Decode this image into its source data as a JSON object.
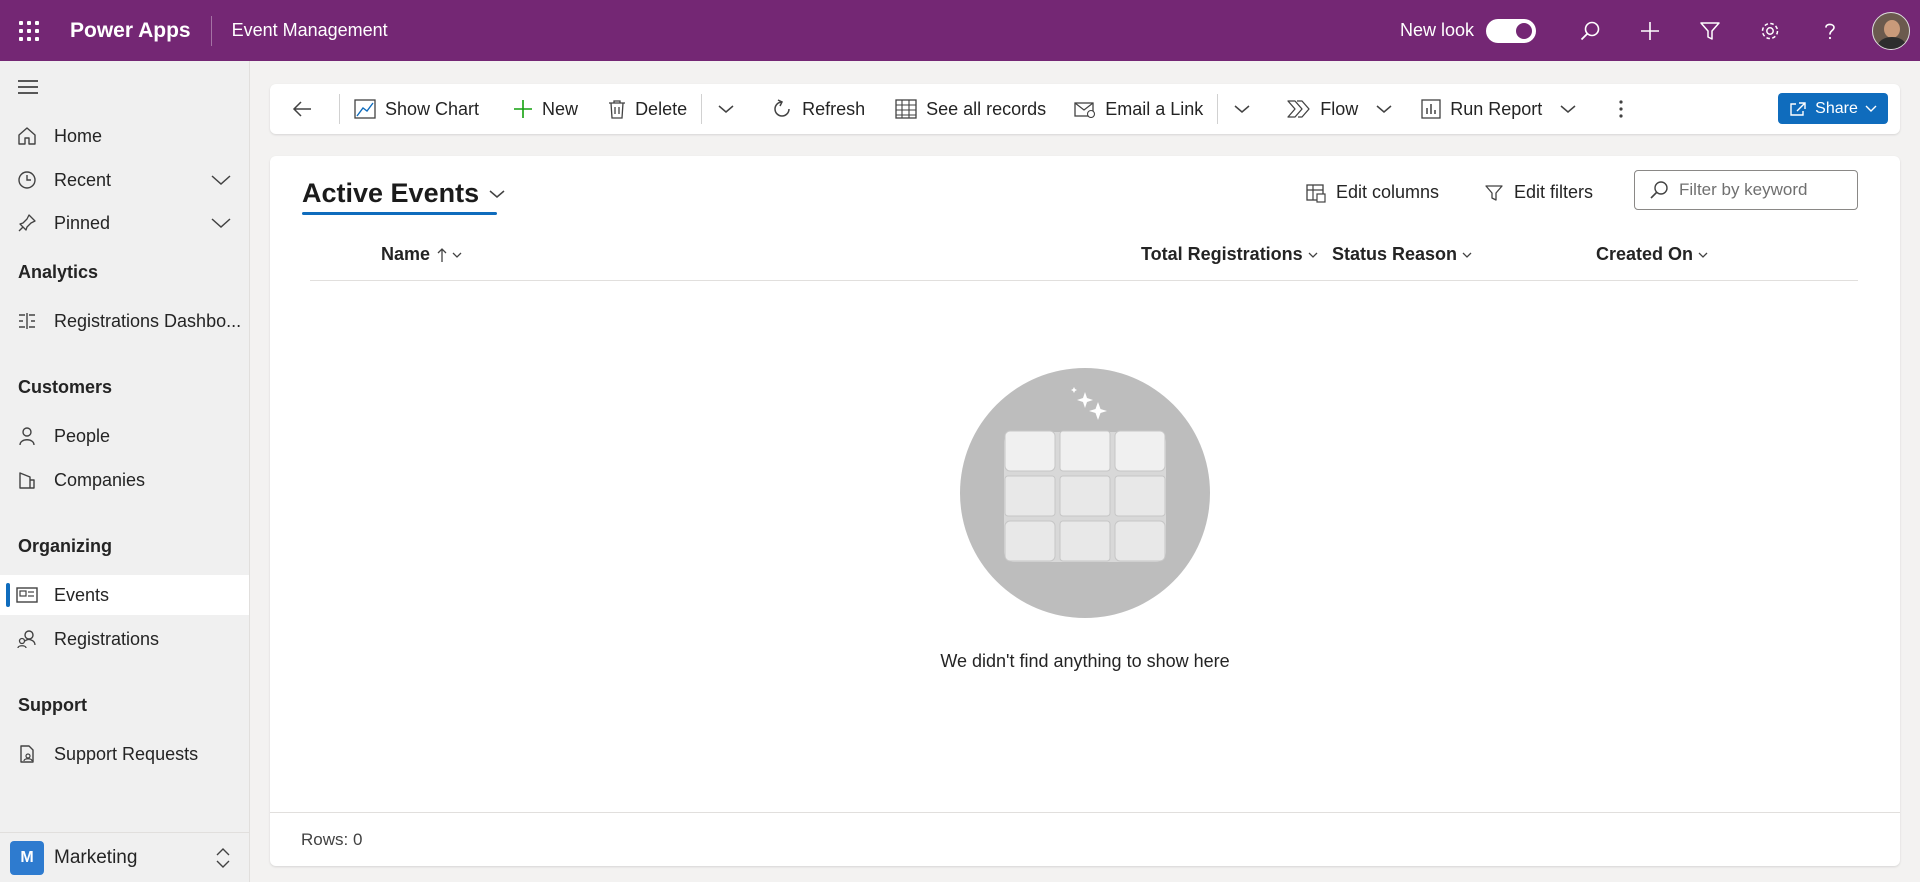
{
  "header": {
    "app_name": "Power Apps",
    "environment": "Event Management",
    "new_look_label": "New look",
    "new_look_on": true,
    "brand_color": "#742774",
    "icons": [
      "waffle-icon",
      "search-icon",
      "plus-icon",
      "filter-icon",
      "gear-icon",
      "help-icon",
      "avatar"
    ]
  },
  "sidebar": {
    "items": {
      "home": "Home",
      "recent": "Recent",
      "pinned": "Pinned",
      "registrations_dashboard": "Registrations Dashbo...",
      "people": "People",
      "companies": "Companies",
      "events": "Events",
      "registrations": "Registrations",
      "support_requests": "Support Requests"
    },
    "sections": {
      "analytics": "Analytics",
      "customers": "Customers",
      "organizing": "Organizing",
      "support": "Support"
    },
    "selected": "Events",
    "area": {
      "badge": "M",
      "label": "Marketing"
    }
  },
  "commandbar": {
    "show_chart": "Show Chart",
    "new": "New",
    "delete": "Delete",
    "refresh": "Refresh",
    "see_all_records": "See all records",
    "email_link": "Email a Link",
    "flow": "Flow",
    "run_report": "Run Report",
    "share": "Share",
    "accent_color": "#0f6cbd"
  },
  "view": {
    "title": "Active Events",
    "edit_columns": "Edit columns",
    "edit_filters": "Edit filters",
    "filter_placeholder": "Filter by keyword",
    "filter_value": "",
    "columns": {
      "name": "Name",
      "total_registrations": "Total Registrations",
      "status_reason": "Status Reason",
      "created_on": "Created On"
    },
    "empty_message": "We didn't find anything to show here",
    "rows_label": "Rows: 0"
  }
}
